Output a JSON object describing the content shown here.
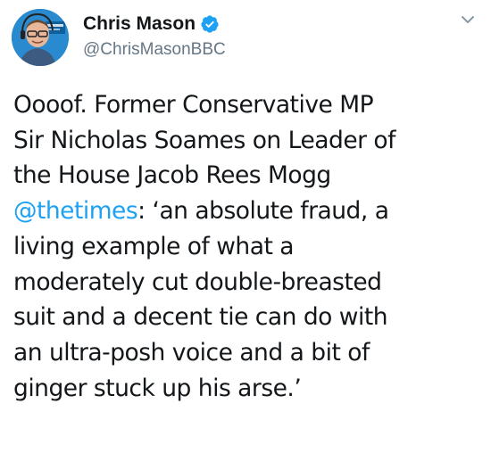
{
  "author": {
    "display_name": "Chris Mason",
    "handle": "@ChrisMasonBBC",
    "verified": true,
    "avatar_icon": "profile-photo"
  },
  "tweet": {
    "lines": [
      {
        "text": "Oooof. Former Conservative MP"
      },
      {
        "text": "Sir Nicholas Soames on Leader of"
      },
      {
        "text": "the House Jacob Rees Mogg"
      },
      {
        "mention": "@thetimes",
        "text": ": ‘an absolute fraud, a"
      },
      {
        "text": "living example of what a"
      },
      {
        "text": "moderately cut double-breasted"
      },
      {
        "text": "suit and a decent tie can do with"
      },
      {
        "text": "an ultra-posh voice and a bit of"
      },
      {
        "text": "ginger stuck up his arse.’"
      }
    ]
  },
  "colors": {
    "link": "#1da1f2",
    "secondary_text": "#657786",
    "primary_text": "#14171a",
    "verified_badge": "#1da1f2"
  },
  "icons": {
    "verified": "verified-badge-icon",
    "menu": "chevron-down-icon"
  }
}
